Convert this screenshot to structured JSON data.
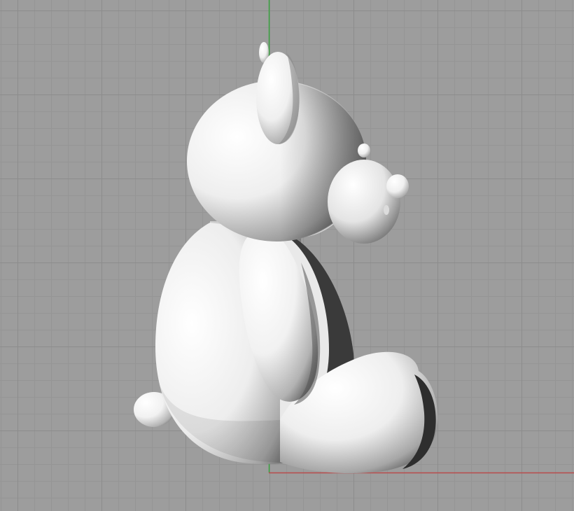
{
  "viewport": {
    "view": "right",
    "background_color": "#9d9d9d",
    "grid_minor_color": "#959595",
    "grid_major_color": "#8c8c8c",
    "axis_colors": {
      "y_axis": "#3aa640",
      "x_axis": "#b84c4c"
    }
  },
  "model": {
    "object": "teddy-bear",
    "shading": "shaded",
    "color": "#ffffff"
  }
}
